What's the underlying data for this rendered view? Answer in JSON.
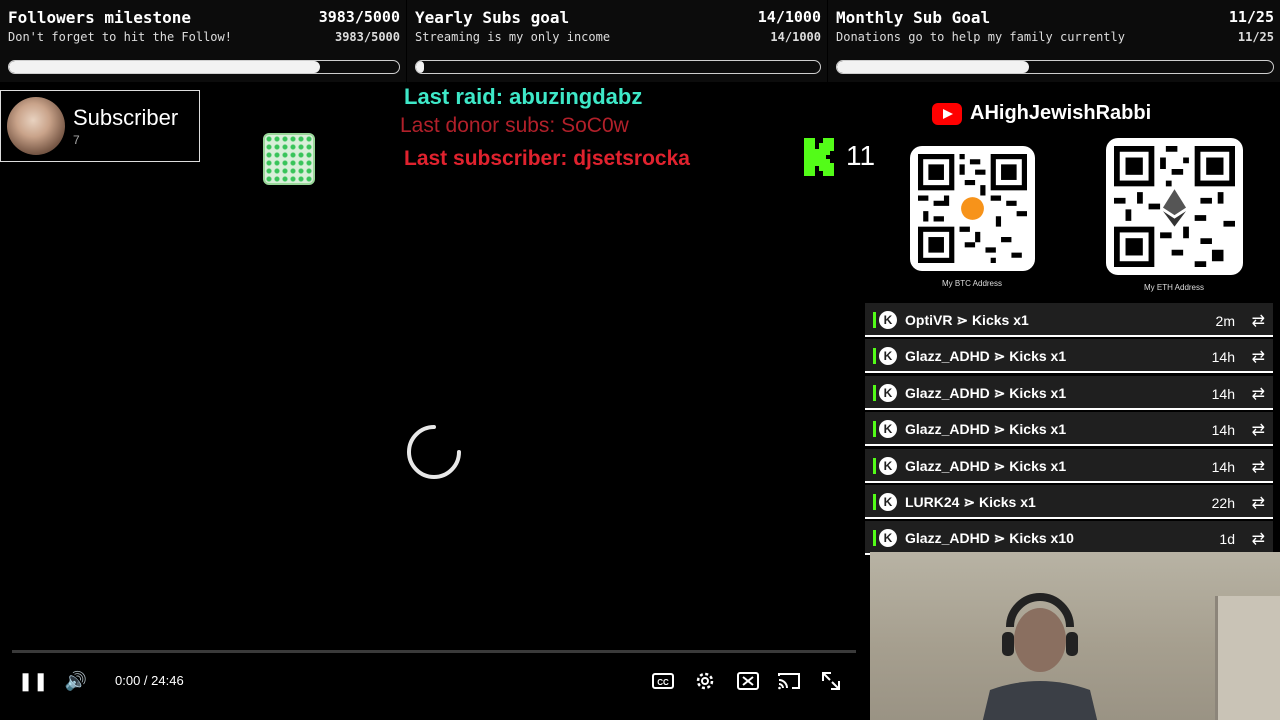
{
  "goals": [
    {
      "title": "Followers milestone",
      "count": "3983/5000",
      "subtitle": "Don't forget to hit the Follow!",
      "count_small": "3983/5000",
      "progress": 0.7966
    },
    {
      "title": "Yearly Subs goal",
      "count": "14/1000",
      "subtitle": "Streaming is my only income",
      "count_small": "14/1000",
      "progress": 0.014
    },
    {
      "title": "Monthly Sub Goal",
      "count": "11/25",
      "subtitle": "Donations go to help my family currently",
      "count_small": "11/25",
      "progress": 0.44
    }
  ],
  "subscriber_card": {
    "label": "Subscriber",
    "count": "7"
  },
  "events": {
    "last_raid": "Last raid: abuzingdabz",
    "last_donor": "Last donor subs: SoC0w",
    "last_subscriber": "Last subscriber: djsetsrocka"
  },
  "kick_count": "11",
  "youtube": {
    "channel": "AHighJewishRabbi",
    "icon": "youtube-icon"
  },
  "qr": [
    {
      "caption": "My BTC Address",
      "center_icon": "bitcoin-icon"
    },
    {
      "caption": "My ETH Address",
      "center_icon": "ethereum-icon"
    }
  ],
  "alerts": [
    {
      "text": "OptiVR ⋗ Kicks x1",
      "time": "2m"
    },
    {
      "text": "Glazz_ADHD ⋗ Kicks x1",
      "time": "14h"
    },
    {
      "text": "Glazz_ADHD ⋗ Kicks x1",
      "time": "14h"
    },
    {
      "text": "Glazz_ADHD ⋗ Kicks x1",
      "time": "14h"
    },
    {
      "text": "Glazz_ADHD ⋗ Kicks x1",
      "time": "14h"
    },
    {
      "text": "LURK24 ⋗ Kicks x1",
      "time": "22h"
    },
    {
      "text": "Glazz_ADHD ⋗ Kicks x10",
      "time": "1d"
    }
  ],
  "player": {
    "time": "0:00 / 24:46",
    "progress": 0.0
  },
  "colors": {
    "raid": "#3ee8c8",
    "donor": "#b1202a",
    "subscriber": "#e0222e",
    "kick_green": "#53fc18",
    "youtube_red": "#ff0000"
  }
}
